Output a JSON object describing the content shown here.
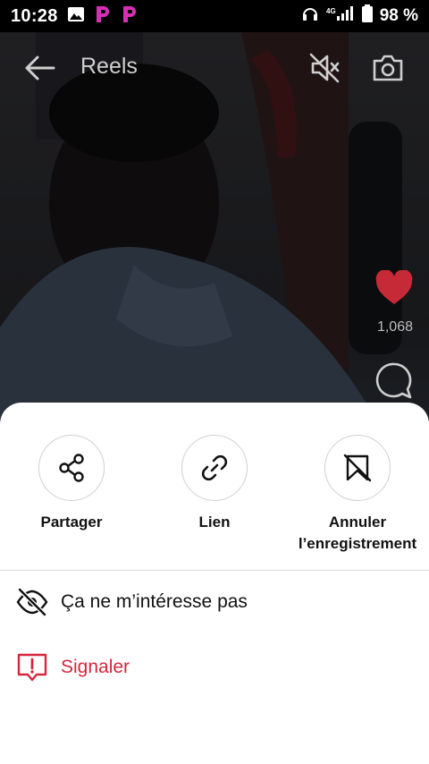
{
  "status_bar": {
    "time": "10:28",
    "battery": "98 %"
  },
  "header": {
    "title": "Reels"
  },
  "video": {
    "likes": "1,068"
  },
  "sheet": {
    "actions": [
      {
        "label": "Partager",
        "icon": "share-icon"
      },
      {
        "label": "Lien",
        "icon": "link-icon"
      },
      {
        "label": "Annuler l’enregistrement",
        "icon": "unsave-icon"
      }
    ],
    "options": [
      {
        "label": "Ça ne m’intéresse pas",
        "icon": "eye-off-icon"
      },
      {
        "label": "Signaler",
        "icon": "report-icon",
        "color": "#d7263d"
      }
    ]
  },
  "colors": {
    "danger": "#d7263d",
    "heart": "#c62a36"
  }
}
